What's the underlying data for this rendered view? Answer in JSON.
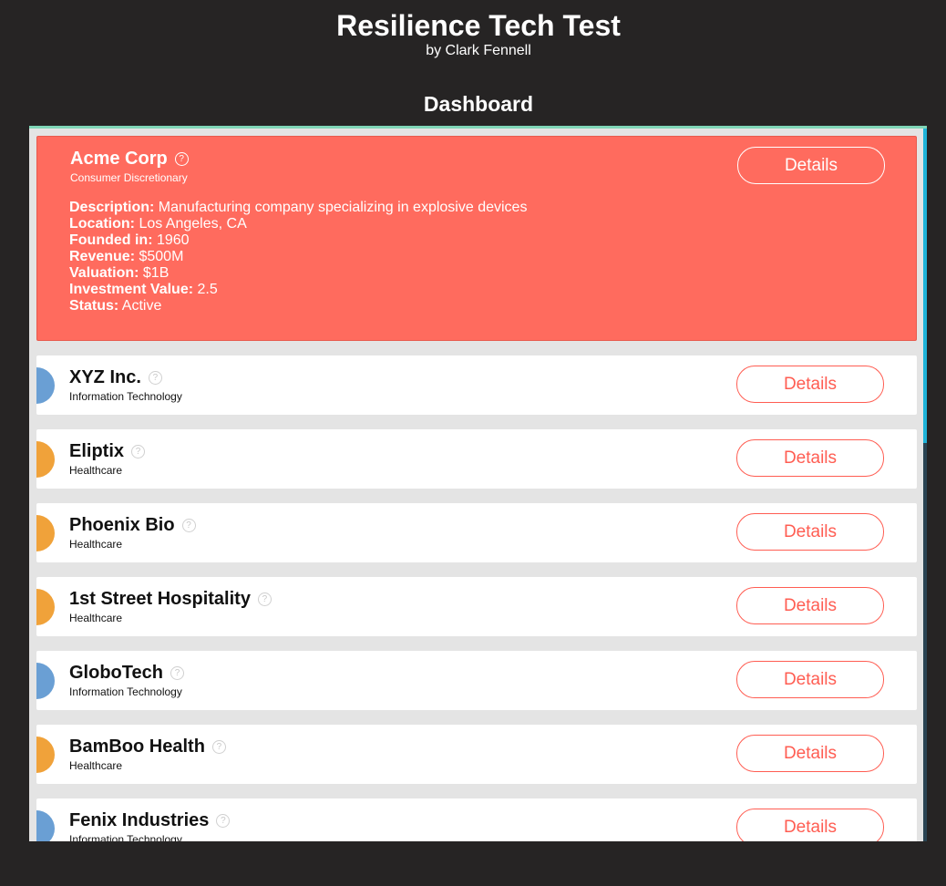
{
  "header": {
    "title": "Resilience Tech Test",
    "subtitle": "by Clark Fennell"
  },
  "dashboard": {
    "title": "Dashboard",
    "details_label": "Details"
  },
  "expanded": {
    "name": "Acme Corp",
    "sector": "Consumer Discretionary",
    "details": [
      {
        "label": "Description:",
        "value": " Manufacturing company specializing in explosive devices"
      },
      {
        "label": "Location:",
        "value": " Los Angeles, CA"
      },
      {
        "label": "Founded in:",
        "value": " 1960"
      },
      {
        "label": "Revenue:",
        "value": " $500M"
      },
      {
        "label": "Valuation:",
        "value": " $1B"
      },
      {
        "label": "Investment Value:",
        "value": " 2.5"
      },
      {
        "label": "Status:",
        "value": " Active"
      }
    ]
  },
  "companies": [
    {
      "name": "XYZ Inc.",
      "sector": "Information Technology",
      "color": "#6a9fd4"
    },
    {
      "name": "Eliptix",
      "sector": "Healthcare",
      "color": "#f0a23a"
    },
    {
      "name": "Phoenix Bio",
      "sector": "Healthcare",
      "color": "#f0a23a"
    },
    {
      "name": "1st Street Hospitality",
      "sector": "Healthcare",
      "color": "#f0a23a"
    },
    {
      "name": "GloboTech",
      "sector": "Information Technology",
      "color": "#6a9fd4"
    },
    {
      "name": "BamBoo Health",
      "sector": "Healthcare",
      "color": "#f0a23a"
    },
    {
      "name": "Fenix Industries",
      "sector": "Information Technology",
      "color": "#6a9fd4"
    }
  ],
  "colors": {
    "expanded_card": "#ff6b5e",
    "accent": "#ff5d52",
    "it_sector": "#6a9fd4",
    "healthcare_sector": "#f0a23a"
  },
  "icons": {
    "help": "question-circle-icon"
  }
}
